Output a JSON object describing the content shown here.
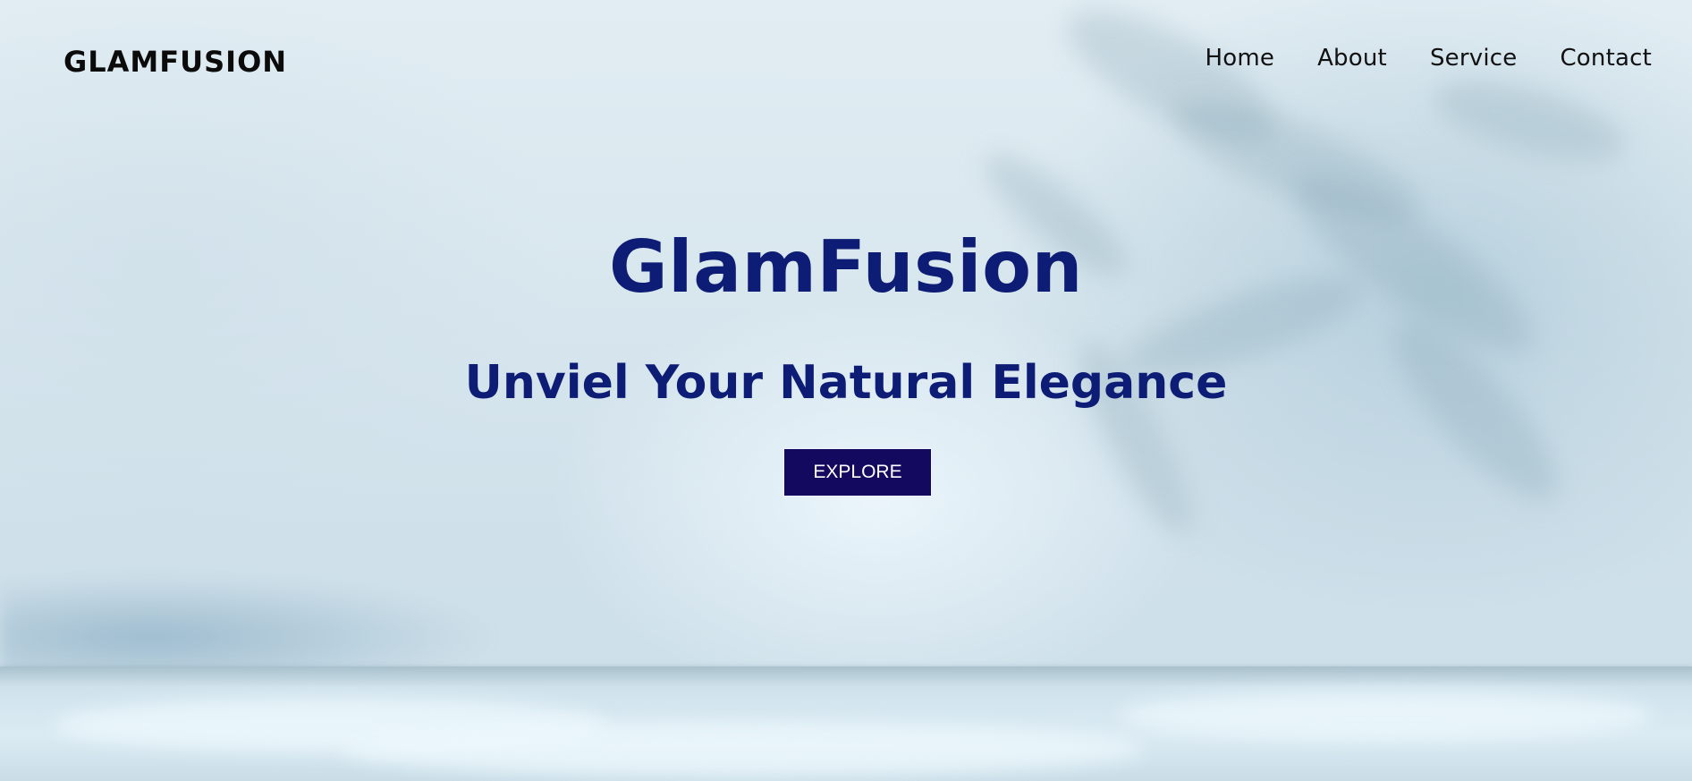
{
  "header": {
    "logo": "GLAMFUSION",
    "nav": [
      {
        "label": "Home"
      },
      {
        "label": "About"
      },
      {
        "label": "Service"
      },
      {
        "label": "Contact"
      }
    ]
  },
  "hero": {
    "title": "GlamFusion",
    "subtitle": "Unviel Your Natural Elegance",
    "button_label": "EXPLORE"
  },
  "colors": {
    "accent_text": "#0d1c74",
    "button_bg": "#13095f",
    "button_text": "#ffffff",
    "background": "#dbe9f0"
  }
}
